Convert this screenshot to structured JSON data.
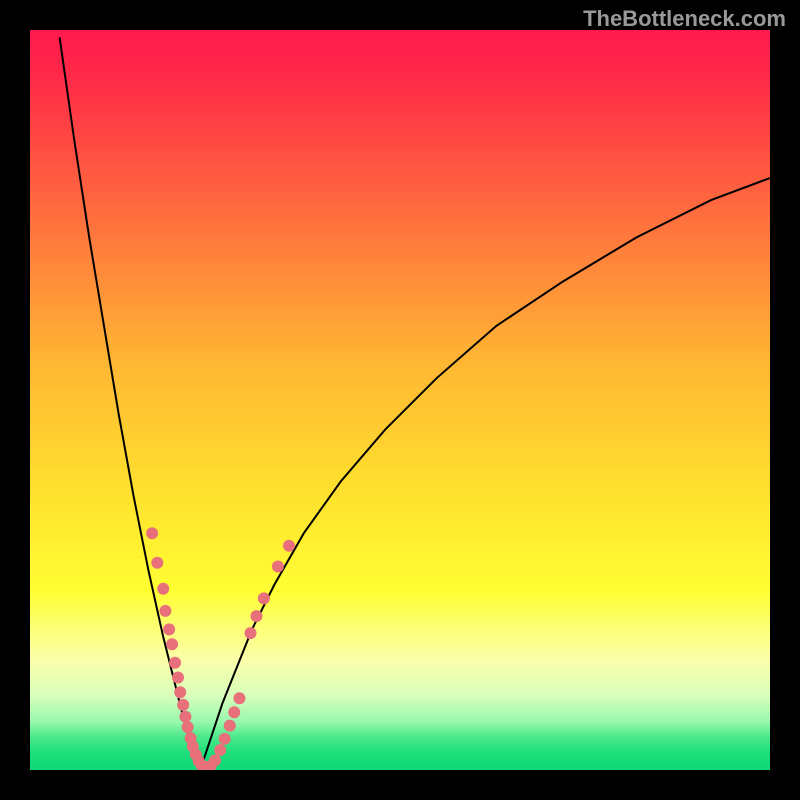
{
  "watermark": "TheBottleneck.com",
  "chart_data": {
    "type": "line",
    "title": "",
    "xlabel": "",
    "ylabel": "",
    "xlim": [
      0,
      100
    ],
    "ylim": [
      0,
      100
    ],
    "x_min_curve": 23,
    "gradient_stops": [
      {
        "offset": 0.0,
        "color": "#ff1a4d"
      },
      {
        "offset": 0.06,
        "color": "#ff2848"
      },
      {
        "offset": 0.45,
        "color": "#ffb733"
      },
      {
        "offset": 0.63,
        "color": "#ffe22e"
      },
      {
        "offset": 0.76,
        "color": "#ffff33"
      },
      {
        "offset": 0.8,
        "color": "#fcff6a"
      },
      {
        "offset": 0.85,
        "color": "#fbffa8"
      },
      {
        "offset": 0.9,
        "color": "#d8ffbc"
      },
      {
        "offset": 0.935,
        "color": "#97f8ac"
      },
      {
        "offset": 0.955,
        "color": "#4de88a"
      },
      {
        "offset": 0.975,
        "color": "#1fe07b"
      },
      {
        "offset": 1.0,
        "color": "#0cd876"
      }
    ],
    "curve_left": {
      "x": [
        4,
        6,
        8,
        10,
        12,
        14,
        16,
        18,
        20,
        21,
        22,
        22.5,
        23
      ],
      "y": [
        99,
        85,
        72,
        60,
        48,
        37,
        27,
        18,
        10,
        6,
        3,
        1,
        0
      ]
    },
    "curve_right": {
      "x": [
        23,
        24,
        26,
        28,
        30,
        33,
        37,
        42,
        48,
        55,
        63,
        72,
        82,
        92,
        100
      ],
      "y": [
        0,
        3,
        9,
        14,
        19,
        25,
        32,
        39,
        46,
        53,
        60,
        66,
        72,
        77,
        80
      ]
    },
    "dot_clusters": [
      {
        "x": 16.5,
        "y": 32,
        "r": 6
      },
      {
        "x": 17.2,
        "y": 28,
        "r": 6
      },
      {
        "x": 18.0,
        "y": 24.5,
        "r": 6
      },
      {
        "x": 18.3,
        "y": 21.5,
        "r": 6
      },
      {
        "x": 18.8,
        "y": 19,
        "r": 6
      },
      {
        "x": 19.2,
        "y": 17,
        "r": 6
      },
      {
        "x": 19.6,
        "y": 14.5,
        "r": 6
      },
      {
        "x": 20.0,
        "y": 12.5,
        "r": 6
      },
      {
        "x": 20.3,
        "y": 10.5,
        "r": 6
      },
      {
        "x": 20.7,
        "y": 8.8,
        "r": 6
      },
      {
        "x": 21.0,
        "y": 7.2,
        "r": 6
      },
      {
        "x": 21.3,
        "y": 5.8,
        "r": 6
      },
      {
        "x": 21.7,
        "y": 4.3,
        "r": 6
      },
      {
        "x": 22.0,
        "y": 3.2,
        "r": 6
      },
      {
        "x": 22.4,
        "y": 2.1,
        "r": 6
      },
      {
        "x": 22.8,
        "y": 1.2,
        "r": 6
      },
      {
        "x": 23.2,
        "y": 0.6,
        "r": 6
      },
      {
        "x": 23.8,
        "y": 0.4,
        "r": 6
      },
      {
        "x": 24.4,
        "y": 0.5,
        "r": 6
      },
      {
        "x": 25.0,
        "y": 1.3,
        "r": 6
      },
      {
        "x": 25.7,
        "y": 2.7,
        "r": 6
      },
      {
        "x": 26.3,
        "y": 4.2,
        "r": 6
      },
      {
        "x": 27.0,
        "y": 6.0,
        "r": 6
      },
      {
        "x": 27.6,
        "y": 7.8,
        "r": 6
      },
      {
        "x": 28.3,
        "y": 9.7,
        "r": 6
      },
      {
        "x": 29.8,
        "y": 18.5,
        "r": 6
      },
      {
        "x": 30.6,
        "y": 20.8,
        "r": 6
      },
      {
        "x": 31.6,
        "y": 23.2,
        "r": 6
      },
      {
        "x": 33.5,
        "y": 27.5,
        "r": 6
      },
      {
        "x": 35.0,
        "y": 30.3,
        "r": 6
      }
    ],
    "dot_color": "#e8707b",
    "curve_color": "#000000",
    "curve_width": 2
  }
}
